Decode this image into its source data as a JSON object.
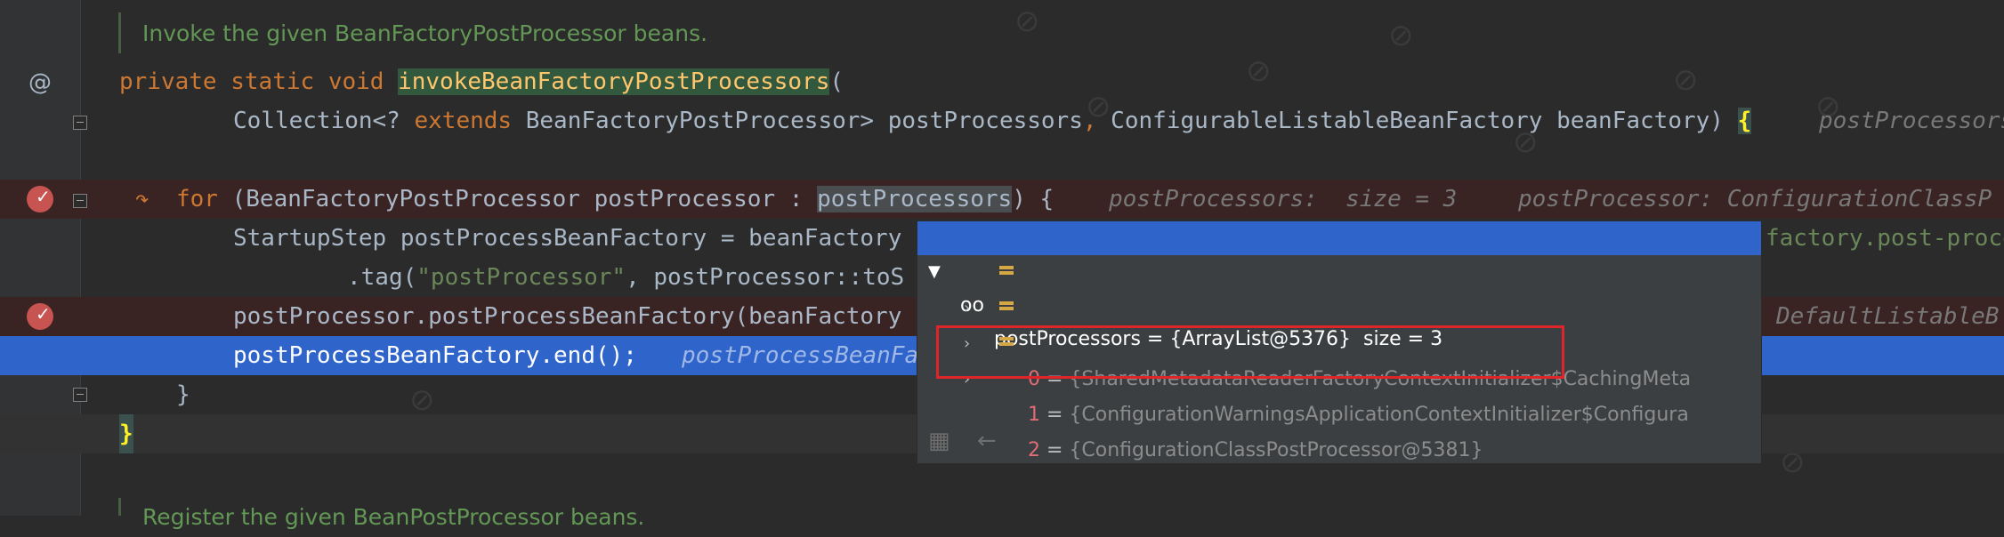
{
  "colors": {
    "background": "#2b2b2b",
    "keyword": "#cc7832",
    "method": "#ffc66d",
    "string": "#6a8759",
    "selection": "#2f65ca",
    "breakpoint": "#c75450"
  },
  "doc_comment_top": "Invoke the given BeanFactoryPostProcessor beans.",
  "gutter": {
    "at_symbol": "@"
  },
  "line_signature": {
    "kw_private": "private",
    "kw_static": "static",
    "kw_void": "void",
    "method_name": "invokeBeanFactoryPostProcessors",
    "open_paren": "("
  },
  "line_params": {
    "part1": "Collection<? ",
    "kw_extends": "extends",
    "part2": " BeanFactoryPostProcessor> postProcessors",
    "comma": ",",
    "part3": " ConfigurableListableBeanFactory beanFactory) ",
    "brace": "{",
    "hint": "postProcessors"
  },
  "line_for": {
    "kw_for": "for",
    "part1": " (BeanFactoryPostProcessor postProcessor : ",
    "var": "postProcessors",
    "part2": ") {",
    "hint1": "postProcessors:  size = 3",
    "hint2": "postProcessor: ConfigurationClassP"
  },
  "line_startup": {
    "text": "StartupStep postProcessBeanFactory = beanFactory",
    "tail": "factory.post-proces"
  },
  "line_tag": {
    "prefix": ".tag(",
    "string": "\"postProcessor\"",
    "suffix": ", postProcessor::toS"
  },
  "line_invoke": {
    "text": "postProcessor.postProcessBeanFactory(beanFactory",
    "tail": "DefaultListableB"
  },
  "line_end": {
    "text": "postProcessBeanFactory.end();",
    "semicolon": ";",
    "hint": "postProcessBeanFa"
  },
  "line_close_inner": "}",
  "line_close_outer": "}",
  "doc_comment_bottom": "Register the given BeanPostProcessor beans.",
  "debug_popup": {
    "header": "postProcessors = {ArrayList@5376}  size = 3",
    "rows": [
      {
        "index": "0",
        "eq": " = ",
        "value": "{SharedMetadataReaderFactoryContextInitializer$CachingMeta"
      },
      {
        "index": "1",
        "eq": " = ",
        "value": "{ConfigurationWarningsApplicationContextInitializer$Configura"
      },
      {
        "index": "2",
        "eq": " = ",
        "value": "{ConfigurationClassPostProcessor@5381}"
      }
    ]
  }
}
